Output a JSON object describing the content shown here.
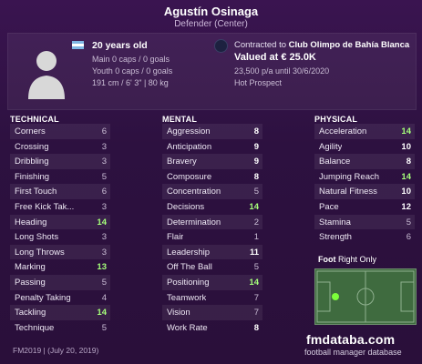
{
  "player": {
    "name": "Agustín Osinaga",
    "position": "Defender (Center)",
    "age": "20 years old",
    "main_caps": "Main 0 caps / 0 goals",
    "youth_caps": "Youth 0 caps / 0 goals",
    "physique": "191 cm / 6' 3\" | 80 kg",
    "contract_prefix": "Contracted to ",
    "club": "Club Olimpo de Bahía Blanca",
    "value": "Valued at € 25.0K",
    "wage": "23,500 p/a until 30/6/2020",
    "status": "Hot Prospect"
  },
  "technical": {
    "title": "TECHNICAL",
    "items": [
      {
        "label": "Corners",
        "value": "6"
      },
      {
        "label": "Crossing",
        "value": "3"
      },
      {
        "label": "Dribbling",
        "value": "3"
      },
      {
        "label": "Finishing",
        "value": "5"
      },
      {
        "label": "First Touch",
        "value": "6"
      },
      {
        "label": "Free Kick Tak...",
        "value": "3"
      },
      {
        "label": "Heading",
        "value": "14"
      },
      {
        "label": "Long Shots",
        "value": "3"
      },
      {
        "label": "Long Throws",
        "value": "3"
      },
      {
        "label": "Marking",
        "value": "13"
      },
      {
        "label": "Passing",
        "value": "5"
      },
      {
        "label": "Penalty Taking",
        "value": "4"
      },
      {
        "label": "Tackling",
        "value": "14"
      },
      {
        "label": "Technique",
        "value": "5"
      }
    ]
  },
  "mental": {
    "title": "MENTAL",
    "items": [
      {
        "label": "Aggression",
        "value": "8"
      },
      {
        "label": "Anticipation",
        "value": "9"
      },
      {
        "label": "Bravery",
        "value": "9"
      },
      {
        "label": "Composure",
        "value": "8"
      },
      {
        "label": "Concentration",
        "value": "5"
      },
      {
        "label": "Decisions",
        "value": "14"
      },
      {
        "label": "Determination",
        "value": "2"
      },
      {
        "label": "Flair",
        "value": "1"
      },
      {
        "label": "Leadership",
        "value": "11"
      },
      {
        "label": "Off The Ball",
        "value": "5"
      },
      {
        "label": "Positioning",
        "value": "14"
      },
      {
        "label": "Teamwork",
        "value": "7"
      },
      {
        "label": "Vision",
        "value": "7"
      },
      {
        "label": "Work Rate",
        "value": "8"
      }
    ]
  },
  "physical": {
    "title": "PHYSICAL",
    "items": [
      {
        "label": "Acceleration",
        "value": "14"
      },
      {
        "label": "Agility",
        "value": "10"
      },
      {
        "label": "Balance",
        "value": "8"
      },
      {
        "label": "Jumping Reach",
        "value": "14"
      },
      {
        "label": "Natural Fitness",
        "value": "10"
      },
      {
        "label": "Pace",
        "value": "12"
      },
      {
        "label": "Stamina",
        "value": "5"
      },
      {
        "label": "Strength",
        "value": "6"
      }
    ]
  },
  "foot": {
    "label": "Foot",
    "value": "Right Only"
  },
  "footer": {
    "version": "FM2019 | (July 20, 2019)",
    "logo": "fmdataba.com",
    "logo_sub": "football manager database"
  },
  "colors": {
    "high": "#a5ff7a",
    "mid": "#ffffff",
    "low": "#c9bcd4",
    "player_dot": "#7cff3a"
  },
  "icons": {
    "avatar": "player-silhouette-icon",
    "flag": "argentina-flag-icon",
    "club": "club-crest-icon"
  }
}
